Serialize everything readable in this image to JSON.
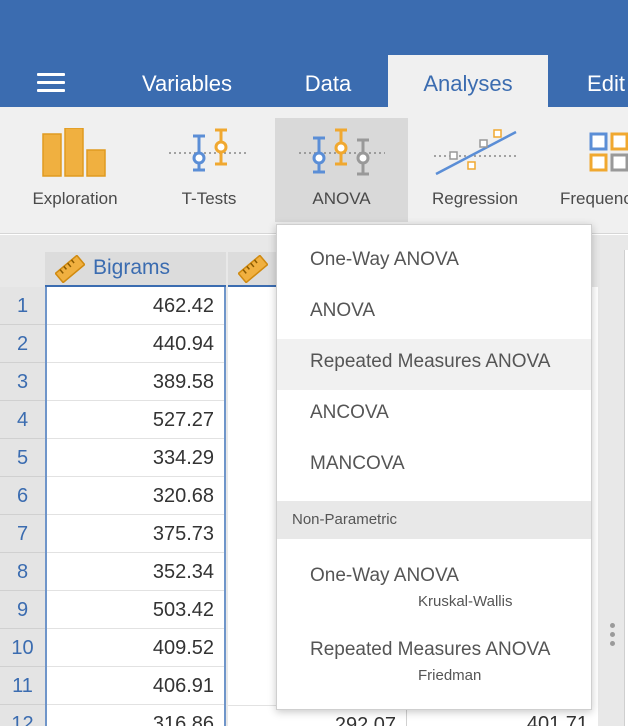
{
  "menu": {
    "icon": "hamburger-icon"
  },
  "tabs": [
    {
      "label": "Variables",
      "active": false
    },
    {
      "label": "Data",
      "active": false
    },
    {
      "label": "Analyses",
      "active": true
    },
    {
      "label": "Edit",
      "active": false
    }
  ],
  "ribbon": {
    "buttons": [
      {
        "label": "Exploration",
        "icon": "exploration-icon"
      },
      {
        "label": "T-Tests",
        "icon": "t-tests-icon"
      },
      {
        "label": "ANOVA",
        "icon": "anova-icon",
        "active": true
      },
      {
        "label": "Regression",
        "icon": "regression-icon"
      },
      {
        "label": "Frequencies",
        "icon": "frequencies-icon"
      }
    ]
  },
  "sheet": {
    "columns": [
      "Bigrams",
      ""
    ],
    "column_icon": "ruler-icon",
    "row_numbers": [
      "1",
      "2",
      "3",
      "4",
      "5",
      "6",
      "7",
      "8",
      "9",
      "10",
      "11",
      "12"
    ],
    "bigrams": [
      "462.42",
      "440.94",
      "389.58",
      "527.27",
      "334.29",
      "320.68",
      "375.73",
      "352.34",
      "503.42",
      "409.52",
      "406.91",
      "316.86"
    ],
    "col2_visible": "292.07",
    "col3_visible": "401.71"
  },
  "dropdown": {
    "items": [
      {
        "label": "One-Way ANOVA",
        "subtitle": ""
      },
      {
        "label": "ANOVA",
        "subtitle": ""
      },
      {
        "label": "Repeated Measures ANOVA",
        "subtitle": "",
        "highlighted": true
      },
      {
        "label": "ANCOVA",
        "subtitle": ""
      },
      {
        "label": "MANCOVA",
        "subtitle": ""
      }
    ],
    "section_header": "Non-Parametric",
    "nonparametric": [
      {
        "label": "One-Way ANOVA",
        "subtitle": "Kruskal-Wallis"
      },
      {
        "label": "Repeated Measures ANOVA",
        "subtitle": "Friedman"
      }
    ]
  },
  "colors": {
    "header_blue": "#3b6cb0",
    "accent_orange": "#f0a830",
    "icon_blue": "#5b8ed6",
    "icon_gray": "#999999"
  }
}
